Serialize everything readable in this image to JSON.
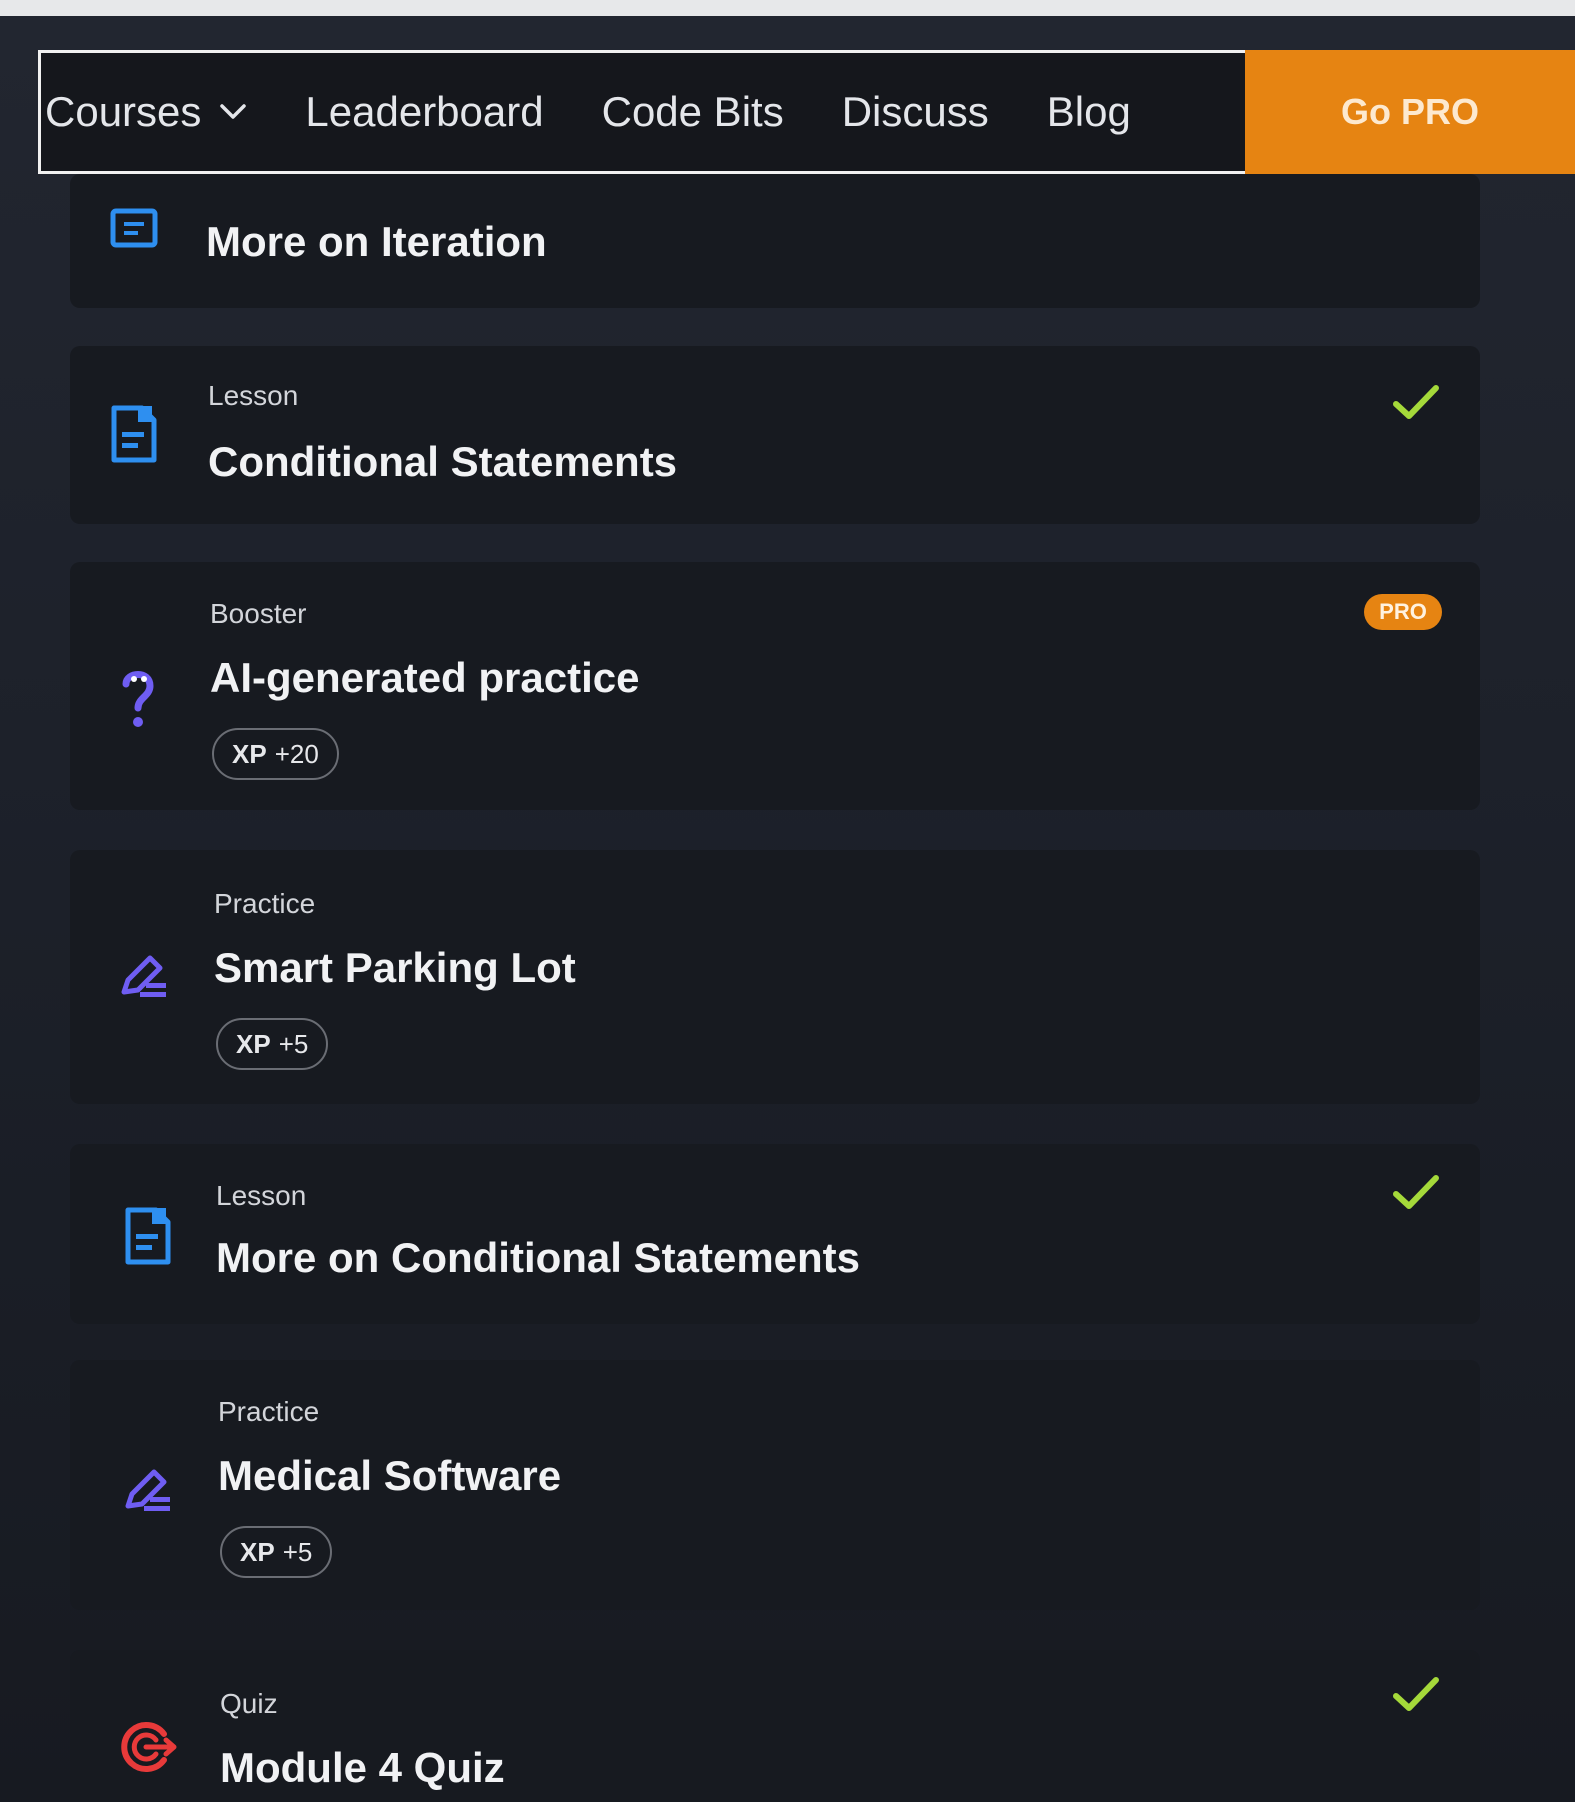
{
  "nav": {
    "items": [
      "Courses",
      "Leaderboard",
      "Code Bits",
      "Discuss",
      "Blog"
    ],
    "go_pro": "Go PRO"
  },
  "items": [
    {
      "type": "",
      "title": "More on Iteration",
      "icon": "module-icon"
    },
    {
      "type": "Lesson",
      "title": "Conditional Statements",
      "icon": "lesson-icon",
      "completed": true
    },
    {
      "type": "Booster",
      "title": "AI-generated practice",
      "xp_label": "XP",
      "xp_value": "+20",
      "badge": "PRO",
      "icon": "question-icon"
    },
    {
      "type": "Practice",
      "title": "Smart Parking Lot",
      "xp_label": "XP",
      "xp_value": "+5",
      "icon": "pencil-icon"
    },
    {
      "type": "Lesson",
      "title": "More on Conditional Statements",
      "icon": "lesson-icon",
      "completed": true
    },
    {
      "type": "Practice",
      "title": "Medical Software",
      "xp_label": "XP",
      "xp_value": "+5",
      "icon": "pencil-icon"
    },
    {
      "type": "Quiz",
      "title": "Module 4 Quiz",
      "icon": "target-icon",
      "completed": true
    }
  ],
  "colors": {
    "accent_orange": "#e68412",
    "check_green": "#a5d93a",
    "icon_blue": "#2e8ff0",
    "icon_violet": "#6f5df2",
    "quiz_red": "#e83a3a"
  }
}
